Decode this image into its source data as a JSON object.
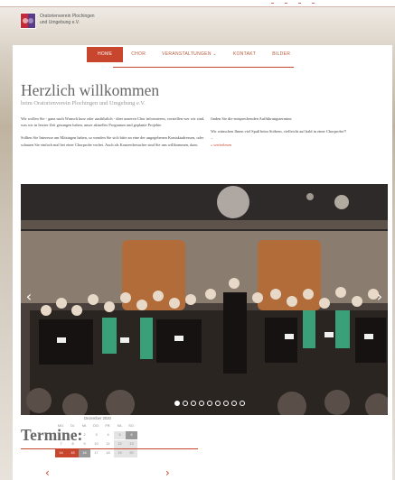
{
  "header": {
    "logo_line1": "Oratorienverein Plochingen",
    "logo_line2": "und Umgebung e.V."
  },
  "nav": {
    "items": [
      {
        "label": "Home",
        "active": true
      },
      {
        "label": "Chor",
        "active": false
      },
      {
        "label": "Veranstaltungen ⌄",
        "active": false
      },
      {
        "label": "Kontakt",
        "active": false
      },
      {
        "label": "Bilder",
        "active": false
      }
    ]
  },
  "welcome": {
    "title": "Herzlich willkommen",
    "subtitle": "beim Oratorienverein Plochingen und Umgebung e.V.",
    "para1": "Wir wollen Sie - ganz nach Wunsch kurz oder ausführlich - über unseren Chor informieren, vorstellen wer wir sind, was wir in letzter Zeit gesungen haben, unser aktuelles Programm und geplante Projekte.",
    "para2": "Sollten Sie Interesse am Mitsingen haben, so wenden Sie sich bitte an eine der angegebenen Kontaktadressen, oder schauen Sie einfach mal bei einer Chorprobe vorbei. Auch als Konzertbesucher sind Sie uns willkommen, dazu",
    "para3": "finden Sie die entsprechenden Aufführungstermine.",
    "para4": "Wir wünschen Ihnen viel Spaß beim Stöbern, vielleicht auf bald in einer Chorprobe?!",
    "ellipsis": "...",
    "more_link": "» weiterlesen"
  },
  "slider": {
    "prev_icon": "chevron-left-icon",
    "next_icon": "chevron-right-icon",
    "prev_glyph": "‹",
    "next_glyph": "›",
    "slide_count": 9,
    "active_slide": 1
  },
  "termine": {
    "title": "Termine:"
  },
  "calendar": {
    "month": "Dezember 2020",
    "weekdays": [
      "MO.",
      "DI.",
      "MI.",
      "DO.",
      "FR.",
      "SA.",
      "SO."
    ],
    "rows": [
      [
        "",
        "1",
        "2",
        "3",
        "4",
        "5",
        "6"
      ],
      [
        "7",
        "8",
        "9",
        "10",
        "11",
        "12",
        "13"
      ],
      [
        "14",
        "15",
        "16",
        "17",
        "18",
        "19",
        "20"
      ]
    ],
    "prev_glyph": "‹",
    "next_glyph": "›"
  },
  "colors": {
    "accent": "#c9462e",
    "heading": "#666666"
  }
}
